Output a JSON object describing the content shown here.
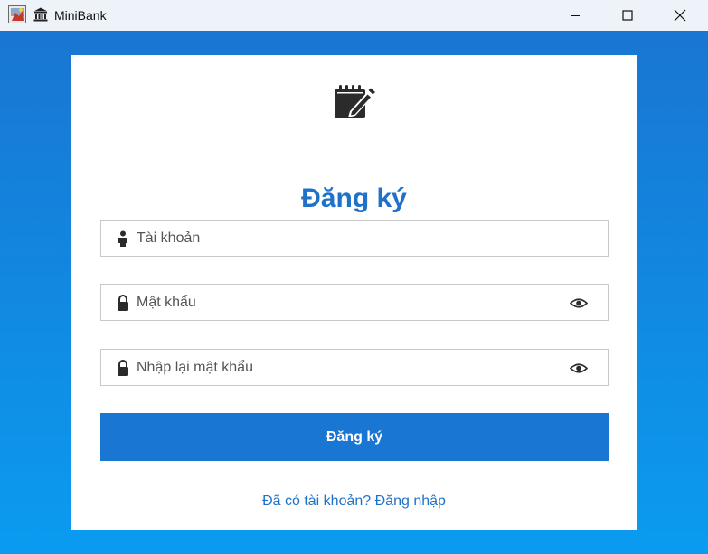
{
  "window": {
    "title": "MiniBank",
    "controls": [
      "minimize",
      "maximize",
      "close"
    ]
  },
  "icons": {
    "app": "java-app-icon",
    "title": "bank-icon",
    "header": "register-note-icon",
    "username": "user-icon",
    "password": "lock-icon",
    "show_password": "eye-icon"
  },
  "form": {
    "heading": "Đăng ký",
    "username_placeholder": "Tài khoản",
    "password_placeholder": "Mật khẩu",
    "confirm_password_placeholder": "Nhập lại mật khẩu",
    "submit_label": "Đăng ký",
    "login_link": "Đã có tài khoản? Đăng nhập"
  },
  "colors": {
    "accent": "#1976d2",
    "heading": "#1f72c8",
    "background_top": "#1976d2",
    "background_bottom": "#0a9bf0"
  }
}
